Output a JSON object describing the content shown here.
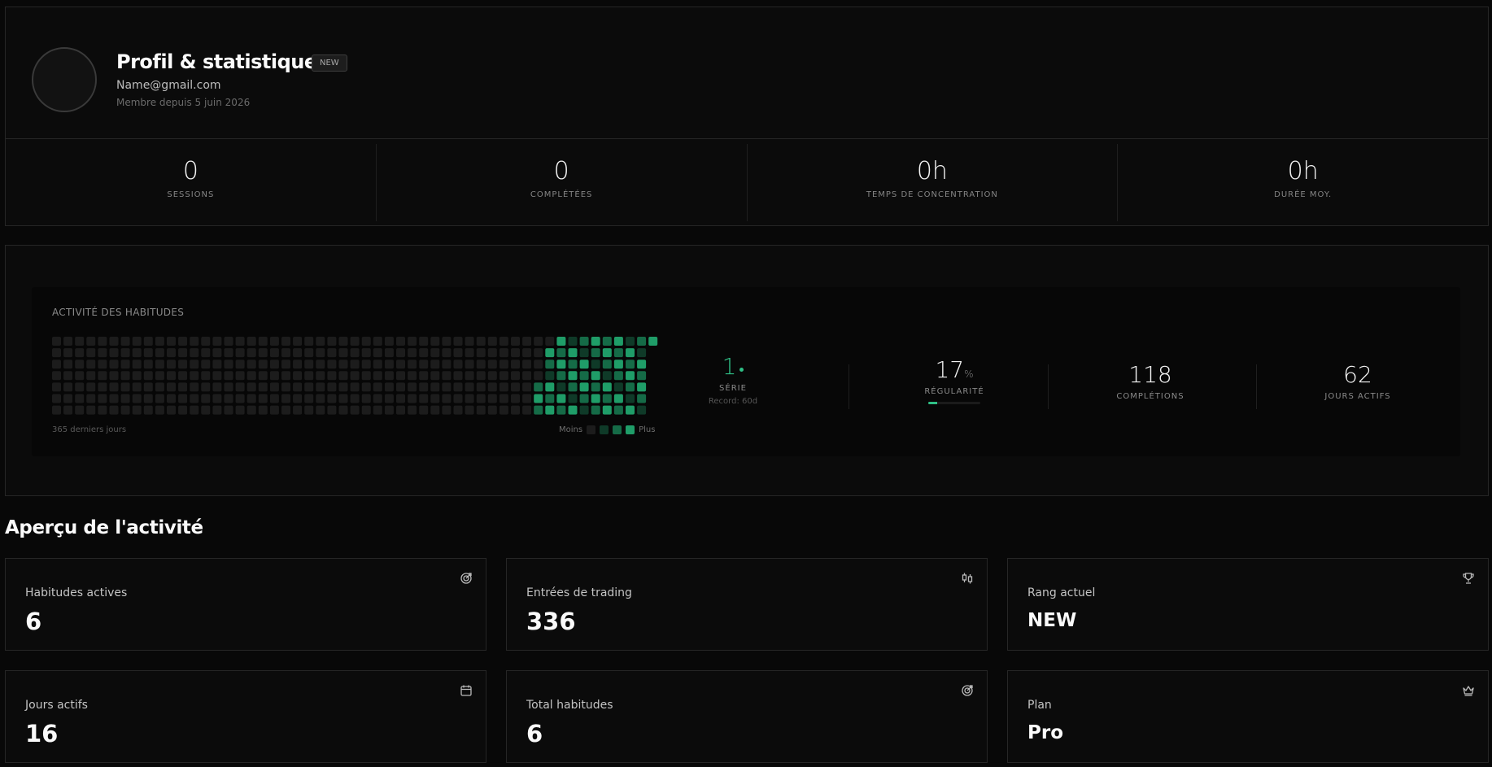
{
  "profile": {
    "title": "Profil & statistiques",
    "badge": "NEW",
    "email": "Name@gmail.com",
    "member_since": "Membre depuis 5 juin 2026",
    "stats": [
      {
        "value": "0",
        "label": "SESSIONS"
      },
      {
        "value": "0",
        "label": "COMPLÉTÉES"
      },
      {
        "value": "0h",
        "label": "TEMPS DE CONCENTRATION"
      },
      {
        "value": "0h",
        "label": "DURÉE MOY."
      }
    ]
  },
  "activity": {
    "title": "ACTIVITÉ DES HABITUDES",
    "range_label": "365 derniers jours",
    "legend_less": "Moins",
    "legend_more": "Plus",
    "colors": {
      "empty": "#1c1c1c",
      "l1": "#0f3a28",
      "l2": "#156b47",
      "l3": "#1f9d68"
    },
    "streak": {
      "value": "1",
      "label": "SÉRIE",
      "record": "Record: 60d"
    },
    "regularity": {
      "value": "17",
      "unit": "%",
      "label": "RÉGULARITÉ",
      "percent": 17
    },
    "completions": {
      "value": "118",
      "label": "COMPLÉTIONS"
    },
    "active_days": {
      "value": "62",
      "label": "JOURS ACTIFS"
    }
  },
  "overview": {
    "title": "Aperçu de l'activité",
    "cards": [
      {
        "label": "Habitudes actives",
        "value": "6",
        "icon": "target-icon"
      },
      {
        "label": "Entrées de trading",
        "value": "336",
        "icon": "candlestick-icon"
      },
      {
        "label": "Rang actuel",
        "value": "NEW",
        "icon": "trophy-icon"
      },
      {
        "label": "Jours actifs",
        "value": "16",
        "icon": "calendar-icon"
      },
      {
        "label": "Total habitudes",
        "value": "6",
        "icon": "target-icon"
      },
      {
        "label": "Plan",
        "value": "Pro",
        "icon": "crown-icon"
      }
    ]
  }
}
